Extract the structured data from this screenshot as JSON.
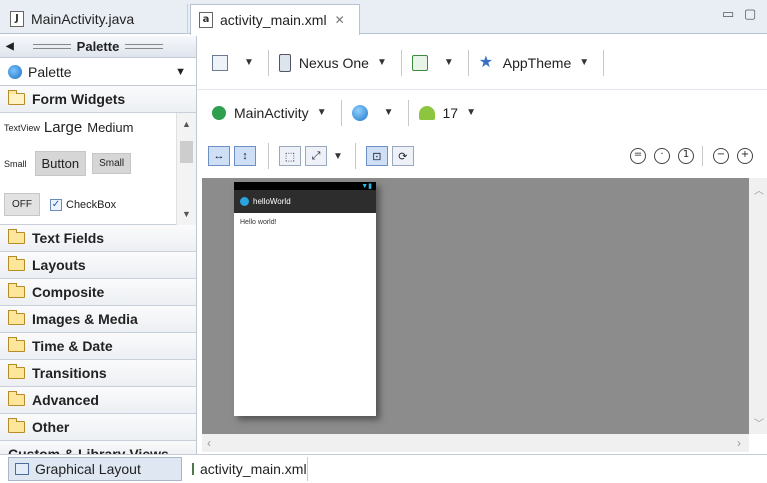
{
  "editor_tabs": [
    {
      "label": "MainActivity.java",
      "icon": "java-file-icon"
    },
    {
      "label": "activity_main.xml",
      "icon": "xml-layout-file-icon",
      "close": "✕"
    }
  ],
  "palette": {
    "header": "Palette",
    "selector": "Palette",
    "form_widgets": {
      "title": "Form Widgets",
      "row1": {
        "textview": "TextView",
        "large": "Large",
        "medium": "Medium"
      },
      "row2": {
        "small": "Small",
        "button": "Button",
        "small_button": "Small"
      },
      "row3": {
        "toggle": "OFF",
        "checkbox": "CheckBox",
        "checked": true
      }
    },
    "sections": [
      "Text Fields",
      "Layouts",
      "Composite",
      "Images & Media",
      "Time & Date",
      "Transitions",
      "Advanced",
      "Other"
    ],
    "custom": "Custom & Library Views"
  },
  "toolbar": {
    "device": "Nexus One",
    "theme": "AppTheme",
    "activity": "MainActivity",
    "api": "17"
  },
  "preview": {
    "app_title": "helloWorld",
    "text": "Hello world!"
  },
  "bottom_tabs": {
    "graphical": "Graphical Layout",
    "xml": "activity_main.xml"
  },
  "colors": {
    "canvas": "#8c8c8c",
    "action_bar": "#2d2d2d",
    "accent": "#33b5e5"
  }
}
